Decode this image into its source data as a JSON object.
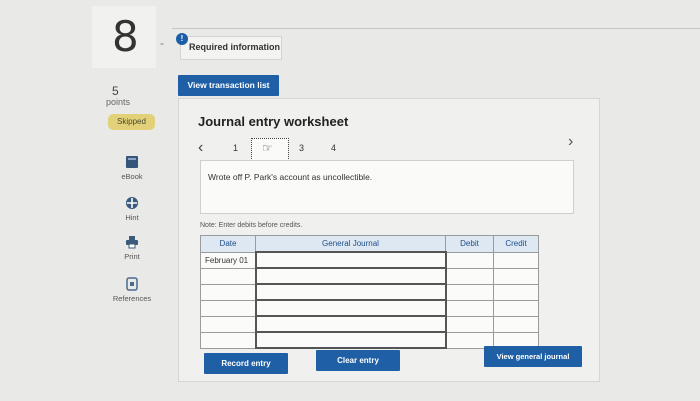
{
  "question": {
    "number": "8",
    "points_value": "5",
    "points_label": "points",
    "status_badge": "Skipped"
  },
  "tools": [
    {
      "label": "eBook",
      "icon": "book-icon"
    },
    {
      "label": "Hint",
      "icon": "hint-icon"
    },
    {
      "label": "Print",
      "icon": "print-icon"
    },
    {
      "label": "References",
      "icon": "references-icon"
    }
  ],
  "header": {
    "info_badge": "!",
    "required_info": "Required information"
  },
  "buttons": {
    "view_transaction_list": "View transaction list",
    "record_entry": "Record entry",
    "clear_entry": "Clear entry",
    "view_general_journal": "View general journal"
  },
  "worksheet": {
    "title": "Journal entry worksheet",
    "pages": [
      "1",
      "2",
      "3",
      "4"
    ],
    "current_page": "2",
    "description": "Wrote off P. Park's account as uncollectible.",
    "note": "Note: Enter debits before credits."
  },
  "journal_table": {
    "headers": [
      "Date",
      "General Journal",
      "Debit",
      "Credit"
    ],
    "rows": [
      {
        "date": "February 01",
        "account": "",
        "debit": "",
        "credit": ""
      },
      {
        "date": "",
        "account": "",
        "debit": "",
        "credit": ""
      },
      {
        "date": "",
        "account": "",
        "debit": "",
        "credit": ""
      },
      {
        "date": "",
        "account": "",
        "debit": "",
        "credit": ""
      },
      {
        "date": "",
        "account": "",
        "debit": "",
        "credit": ""
      },
      {
        "date": "",
        "account": "",
        "debit": "",
        "credit": ""
      }
    ]
  },
  "colors": {
    "primary_button": "#1f5fa6",
    "skipped_badge": "#e3d17a",
    "table_header": "#dde8f2"
  }
}
